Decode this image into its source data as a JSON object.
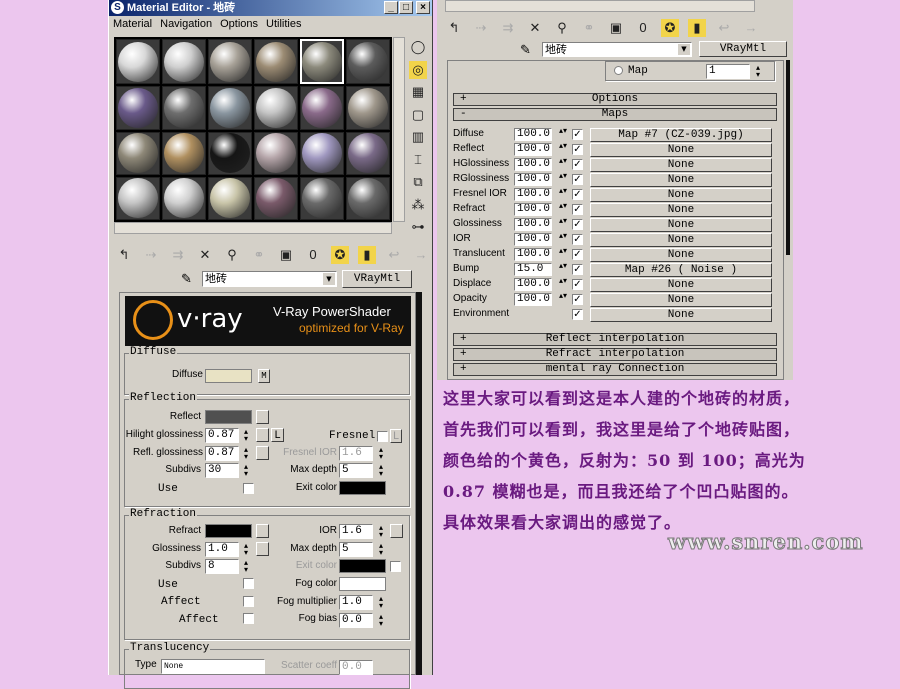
{
  "window": {
    "title": "Material Editor - 地砖",
    "minimize": "_",
    "maximize": "□",
    "close": "×"
  },
  "menu": [
    "Material",
    "Navigation",
    "Options",
    "Utilities"
  ],
  "spheres": [
    "#d8d8d8",
    "#cfcfcf",
    "#a8a298",
    "#9c8c74",
    "#8c8a7c",
    "#5c5c5c",
    "#6a5a8a",
    "#6e6e6e",
    "#8a96a0",
    "#c4c4c4",
    "#8a6a8a",
    "#a0988c",
    "#8e8878",
    "#b09060",
    "#151515",
    "#b4a4a8",
    "#a098c0",
    "#7a6a88",
    "#c4c4c4",
    "#cfcfcf",
    "#c8c4a8",
    "#7a5a6a",
    "#6a6a6a",
    "#6a6a6a"
  ],
  "side_icons": [
    "sample-type-icon",
    "backlight-icon",
    "background-icon",
    "sample-uv-icon",
    "video-check-icon",
    "make-preview-icon",
    "options-icon",
    "select-by-material-icon",
    "material-navigator-icon"
  ],
  "toolbar_icons": [
    "get-material-icon",
    "put-to-scene-icon",
    "assign-to-selection-icon",
    "reset-icon",
    "make-copy-icon",
    "make-unique-icon",
    "put-to-library-icon",
    "material-effects-channel-icon",
    "show-map-icon",
    "show-end-result-icon",
    "go-to-parent-icon",
    "go-forward-icon"
  ],
  "toolbar_effects_label": "0",
  "material_name": "地砖",
  "material_type": "VRayMtl",
  "banner": {
    "logo": "v·ray",
    "line1": "V-Ray PowerShader",
    "line2": "optimized for V-Ray"
  },
  "diffuse": {
    "group": "Diffuse",
    "label": "Diffuse",
    "map_btn": "M",
    "color": "#e8e2c4"
  },
  "reflection": {
    "group": "Reflection",
    "reflect": "Reflect",
    "reflect_color": "#505050",
    "hilight_label": "Hilight glossiness",
    "hilight": "0.87",
    "lock": "L",
    "fresnel": "Fresnel",
    "refl_gloss_label": "Refl. glossiness",
    "refl_gloss": "0.87",
    "fresnel_ior_label": "Fresnel IOR",
    "fresnel_ior": "1.6",
    "subdivs_label": "Subdivs",
    "subdivs": "30",
    "max_depth_label": "Max depth",
    "max_depth": "5",
    "use": "Use",
    "exit_color": "Exit color"
  },
  "refraction": {
    "group": "Refraction",
    "refract": "Refract",
    "ior_label": "IOR",
    "ior": "1.6",
    "gloss_label": "Glossiness",
    "gloss": "1.0",
    "max_depth_label": "Max depth",
    "max_depth": "5",
    "subdivs_label": "Subdivs",
    "subdivs": "8",
    "exit_color": "Exit color",
    "use": "Use",
    "fog_color": "Fog color",
    "affect1": "Affect",
    "fog_mult_label": "Fog multiplier",
    "fog_mult": "1.0",
    "affect2": "Affect",
    "fog_bias_label": "Fog bias",
    "fog_bias": "0.0"
  },
  "translucency": {
    "group": "Translucency",
    "type_label": "Type",
    "type": "None",
    "scatter_label": "Scatter coeff",
    "scatter": "0.0"
  },
  "right": {
    "map_radio": "Map",
    "map_value": "1",
    "options": "Options",
    "maps": "Maps",
    "plus": "+",
    "minus": "-",
    "rows": [
      {
        "label": "Diffuse",
        "amount": "100.0",
        "map": "Map #7 (CZ-039.jpg)"
      },
      {
        "label": "Reflect",
        "amount": "100.0",
        "map": "None"
      },
      {
        "label": "HGlossiness",
        "amount": "100.0",
        "map": "None"
      },
      {
        "label": "RGlossiness",
        "amount": "100.0",
        "map": "None"
      },
      {
        "label": "Fresnel IOR",
        "amount": "100.0",
        "map": "None"
      },
      {
        "label": "Refract",
        "amount": "100.0",
        "map": "None"
      },
      {
        "label": "Glossiness",
        "amount": "100.0",
        "map": "None"
      },
      {
        "label": "IOR",
        "amount": "100.0",
        "map": "None"
      },
      {
        "label": "Translucent",
        "amount": "100.0",
        "map": "None"
      },
      {
        "label": "Bump",
        "amount": "15.0",
        "map": "Map #26  ( Noise )"
      },
      {
        "label": "Displace",
        "amount": "100.0",
        "map": "None"
      },
      {
        "label": "Opacity",
        "amount": "100.0",
        "map": "None"
      },
      {
        "label": "Environment",
        "amount": null,
        "map": "None"
      }
    ],
    "reflect_interp": "Reflect interpolation",
    "refract_interp": "Refract interpolation",
    "mental_ray": "mental ray Connection"
  },
  "note": [
    "这里大家可以看到这是本人建的个地砖的材质，",
    "首先我们可以看到，我这里是给了个地砖贴图，",
    "颜色给的个黄色，反射为：50 到 100；高光为",
    "0.87 模糊也是，而且我还给了个凹凸贴图的。",
    "具体效果看大家调出的感觉了。"
  ],
  "site": "www.snren.com"
}
